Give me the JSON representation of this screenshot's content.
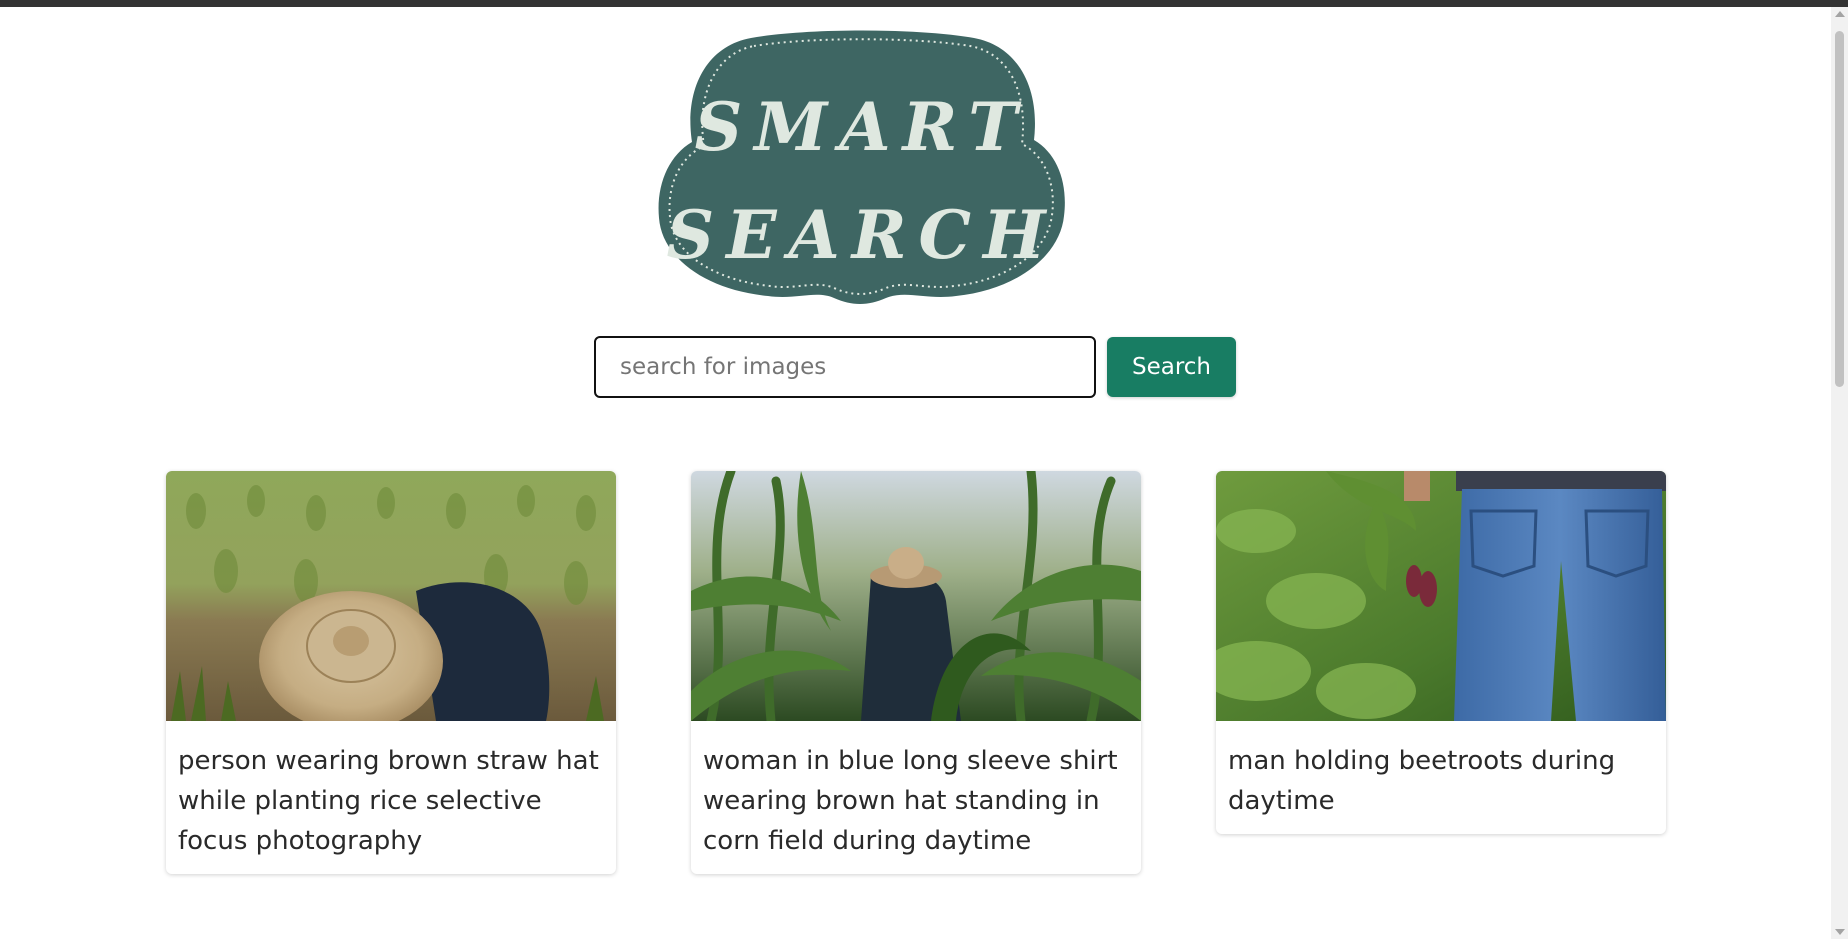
{
  "logo": {
    "line1": "SMART",
    "line2": "SEARCH",
    "bg_color": "#3e6663",
    "text_color": "#dfe8e0"
  },
  "search": {
    "placeholder": "search for images",
    "value": "",
    "button_label": "Search",
    "button_color": "#187d63"
  },
  "results": [
    {
      "caption": "person wearing brown straw hat while planting rice selective focus photography",
      "image": "farmer-straw-hat-rice-field"
    },
    {
      "caption": "woman in blue long sleeve shirt wearing brown hat standing in corn field during daytime",
      "image": "person-hat-corn-field"
    },
    {
      "caption": "man holding beetroots during daytime",
      "image": "man-jeans-holding-beetroots"
    }
  ]
}
